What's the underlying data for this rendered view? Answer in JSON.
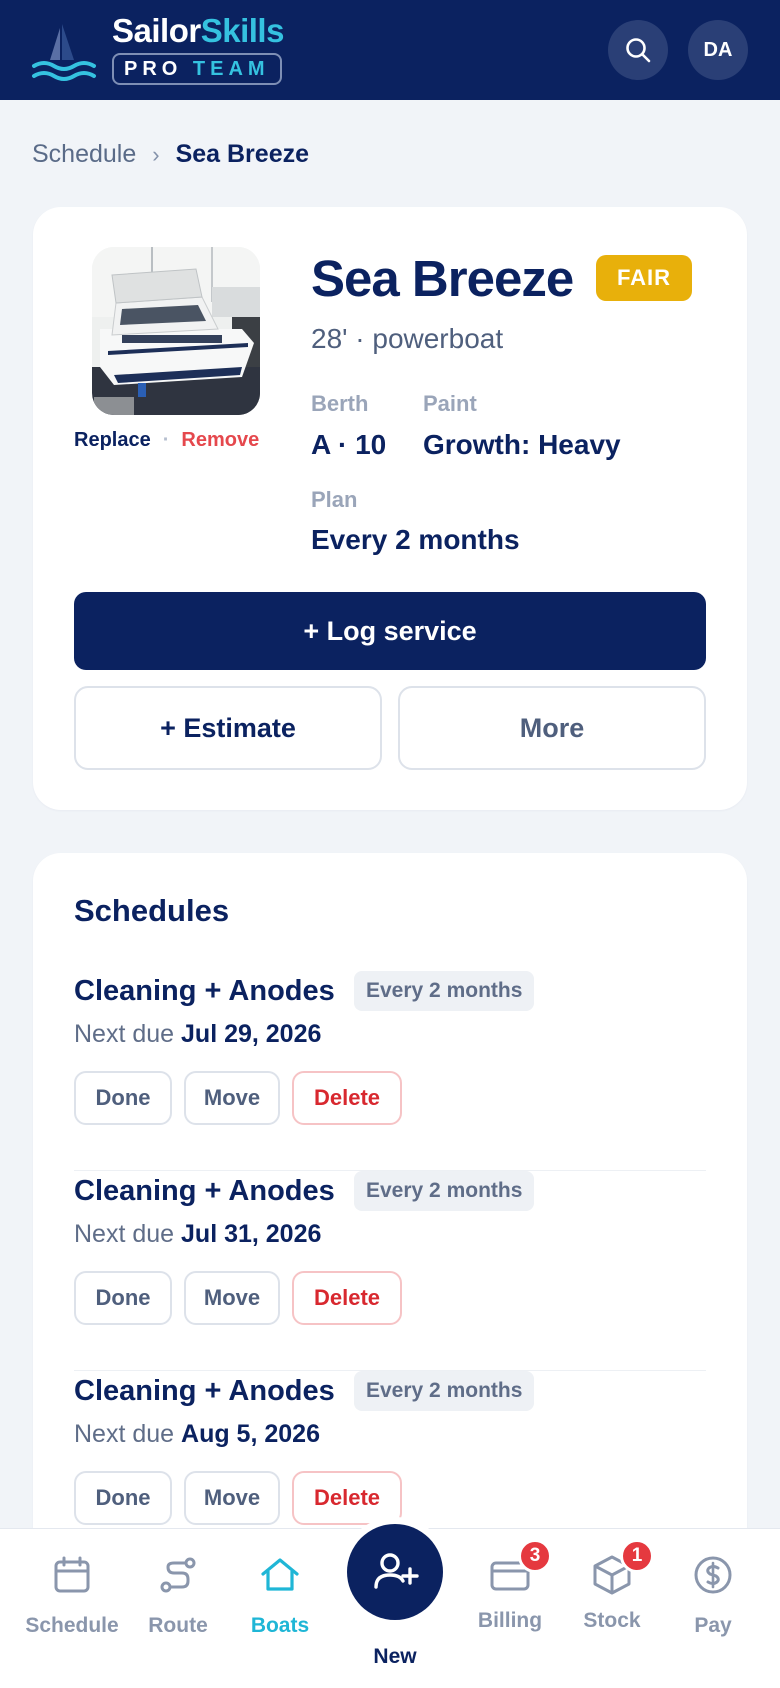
{
  "header": {
    "brand_word1": "Sailor",
    "brand_word2": "Skills",
    "tag_word1": "PRO",
    "tag_word2": "TEAM",
    "avatar_initials": "DA",
    "search_icon": "search-icon"
  },
  "breadcrumb": {
    "parent": "Schedule",
    "separator": "›",
    "current": "Sea Breeze"
  },
  "boat": {
    "name": "Sea Breeze",
    "condition": "FAIR",
    "spec": "28' · powerboat",
    "photo_actions": {
      "replace": "Replace",
      "dot": "·",
      "remove": "Remove"
    },
    "berth_label": "Berth",
    "berth_value": "A · 10",
    "paint_label": "Paint",
    "paint_value": "Growth: Heavy",
    "plan_label": "Plan",
    "plan_value": "Every 2 months",
    "log_service": "+ Log service",
    "estimate": "+ Estimate",
    "more": "More"
  },
  "schedules": {
    "title": "Schedules",
    "items": [
      {
        "name": "Cleaning + Anodes",
        "frequency": "Every 2 months",
        "due_label": "Next due",
        "due_date": "Jul 29, 2026",
        "done": "Done",
        "move": "Move",
        "delete": "Delete"
      },
      {
        "name": "Cleaning + Anodes",
        "frequency": "Every 2 months",
        "due_label": "Next due",
        "due_date": "Jul 31, 2026",
        "done": "Done",
        "move": "Move",
        "delete": "Delete"
      },
      {
        "name": "Cleaning + Anodes",
        "frequency": "Every 2 months",
        "due_label": "Next due",
        "due_date": "Aug 5, 2026",
        "done": "Done",
        "move": "Move",
        "delete": "Delete"
      }
    ]
  },
  "nav": {
    "items": [
      {
        "label": "Schedule",
        "icon": "calendar-icon"
      },
      {
        "label": "Route",
        "icon": "route-icon"
      },
      {
        "label": "Boats",
        "icon": "home-icon",
        "active": true
      },
      {
        "label": "Billing",
        "icon": "card-icon",
        "badge": "3"
      },
      {
        "label": "Stock",
        "icon": "box-icon",
        "badge": "1"
      },
      {
        "label": "Pay",
        "icon": "dollar-icon"
      }
    ],
    "new_label": "New",
    "new_icon": "add-user-icon"
  },
  "colors": {
    "navy": "#0b2260",
    "accent": "#35c2e0",
    "fair": "#e8b00b",
    "danger": "#e5393f"
  }
}
